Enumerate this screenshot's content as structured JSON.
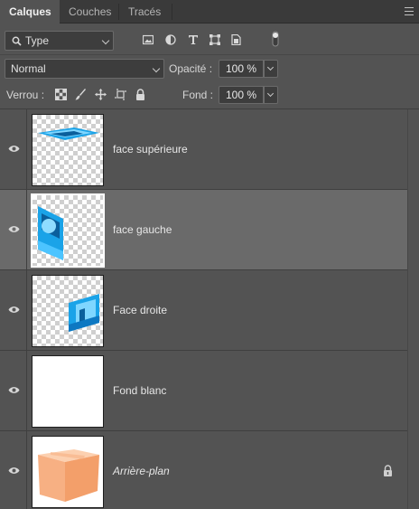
{
  "tabs": [
    {
      "label": "Calques",
      "active": true
    },
    {
      "label": "Couches",
      "active": false
    },
    {
      "label": "Tracés",
      "active": false
    }
  ],
  "filter": {
    "kind_label": "Type",
    "icons": [
      "image-filter-icon",
      "adjustment-filter-icon",
      "type-filter-icon",
      "shape-filter-icon",
      "smart-object-filter-icon"
    ]
  },
  "blend": {
    "mode": "Normal",
    "opacity_label": "Opacité :",
    "opacity_value": "100 %"
  },
  "lock": {
    "label": "Verrou :",
    "fill_label": "Fond :",
    "fill_value": "100 %"
  },
  "layers": [
    {
      "name": "face supérieure",
      "selected": false,
      "visible": true
    },
    {
      "name": "face gauche",
      "selected": true,
      "visible": true
    },
    {
      "name": "Face droite",
      "selected": false,
      "visible": true
    },
    {
      "name": "Fond blanc",
      "selected": false,
      "visible": true
    },
    {
      "name": "Arrière-plan",
      "selected": false,
      "visible": true,
      "locked": true
    }
  ],
  "colors": {
    "panel_bg": "#535353",
    "selected_row": "#6a6a6a",
    "field_bg": "#3d3d3d",
    "accent_blue": "#1aa3e8",
    "box_orange": "#f7b083"
  }
}
